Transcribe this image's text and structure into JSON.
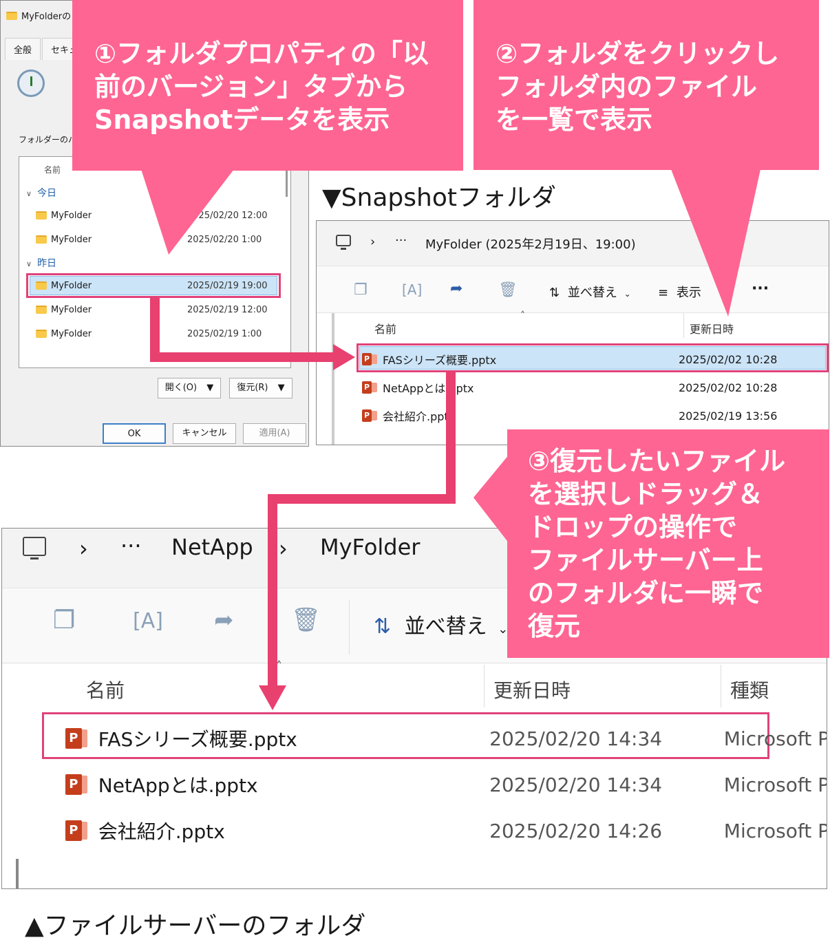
{
  "dialog": {
    "title": "MyFolderの",
    "tabs": [
      "全般",
      "セキュ"
    ],
    "versions_label": "フォルダーのバー",
    "column_name": "名前",
    "groups": [
      {
        "label": "今日",
        "items": [
          {
            "name": "MyFolder",
            "date": "2025/02/20 12:00"
          },
          {
            "name": "MyFolder",
            "date": "2025/02/20 1:00"
          }
        ]
      },
      {
        "label": "昨日",
        "items": [
          {
            "name": "MyFolder",
            "date": "2025/02/19 19:00",
            "selected": true
          },
          {
            "name": "MyFolder",
            "date": "2025/02/19 12:00"
          },
          {
            "name": "MyFolder",
            "date": "2025/02/19 1:00"
          }
        ]
      }
    ],
    "open_button": "開く(O)",
    "restore_button": "復元(R)",
    "ok_button": "OK",
    "cancel_button": "キャンセル",
    "apply_button": "適用(A)"
  },
  "callouts": {
    "step1": "①フォルダプロパティの「以\n前のバージョン」タブから\nSnapshotデータを表示",
    "step2": "②フォルダをクリックし\nフォルダ内のファイル\nを一覧で表示",
    "step3": "③復元したいファイル\nを選択しドラッグ＆\nドロップの操作で\nファイルサーバー上\nのフォルダに一瞬で\n復元"
  },
  "snapshot": {
    "caption": "▼Snapshotフォルダ",
    "breadcrumb_more": "···",
    "path": "MyFolder (2025年2月19日、19:00)",
    "sort_label": "並べ替え",
    "view_label": "表示",
    "more_label": "···",
    "col_name": "名前",
    "col_date": "更新日時",
    "files": [
      {
        "name": "FASシリーズ概要.pptx",
        "date": "2025/02/02 10:28",
        "selected": true
      },
      {
        "name": "NetAppとは.pptx",
        "date": "2025/02/02 10:28"
      },
      {
        "name": "会社紹介.pptx",
        "date": "2025/02/19 13:56"
      }
    ]
  },
  "fileserver": {
    "caption": "▲ファイルサーバーのフォルダ",
    "breadcrumb_more": "···",
    "path_parts": [
      "NetApp",
      "MyFolder"
    ],
    "sort_label": "並べ替え",
    "col_name": "名前",
    "col_date": "更新日時",
    "col_type": "種類",
    "files": [
      {
        "name": "FASシリーズ概要.pptx",
        "date": "2025/02/20 14:34",
        "type": "Microsoft P",
        "selected": true
      },
      {
        "name": "NetAppとは.pptx",
        "date": "2025/02/20 14:34",
        "type": "Microsoft P"
      },
      {
        "name": "会社紹介.pptx",
        "date": "2025/02/20 14:26",
        "type": "Microsoft P"
      }
    ]
  },
  "colors": {
    "callout": "#ff6592",
    "arrow": "#e8406f",
    "selection": "#cce4f7",
    "highlight_border": "#e0427a"
  }
}
